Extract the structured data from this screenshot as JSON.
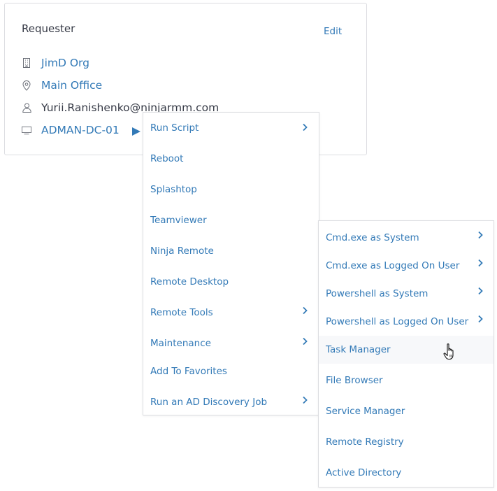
{
  "requester": {
    "title": "Requester",
    "edit_label": "Edit",
    "organization": "JimD Org",
    "location": "Main Office",
    "email": "Yurii.Ranishenko@ninjarmm.com",
    "device": "ADMAN-DC-01"
  },
  "icons": {
    "organization": "building-icon",
    "location": "map-pin-icon",
    "email": "user-icon",
    "device": "monitor-icon",
    "play": "play-icon",
    "submenu": "chevron-right-icon",
    "cursor": "hand-pointer-icon"
  },
  "device_menu": {
    "items": [
      {
        "label": "Run Script",
        "submenu": true
      },
      {
        "label": "Reboot",
        "submenu": false
      },
      {
        "label": "Splashtop",
        "submenu": false
      },
      {
        "label": "Teamviewer",
        "submenu": false
      },
      {
        "label": "Ninja Remote",
        "submenu": false
      },
      {
        "label": "Remote Desktop",
        "submenu": false
      },
      {
        "label": "Remote Tools",
        "submenu": true
      },
      {
        "label": "Maintenance",
        "submenu": true
      },
      {
        "label": "Add To Favorites",
        "submenu": false
      },
      {
        "label": "Run an AD Discovery Job",
        "submenu": true
      }
    ]
  },
  "remote_tools_menu": {
    "hovered_item": "Task Manager",
    "items": [
      {
        "label": "Cmd.exe as System",
        "submenu": true
      },
      {
        "label": "Cmd.exe as Logged On User",
        "submenu": true
      },
      {
        "label": "Powershell as System",
        "submenu": true
      },
      {
        "label": "Powershell as Logged On User",
        "submenu": true
      },
      {
        "label": "Task Manager",
        "submenu": false
      },
      {
        "label": "File Browser",
        "submenu": false
      },
      {
        "label": "Service Manager",
        "submenu": false
      },
      {
        "label": "Remote Registry",
        "submenu": false
      },
      {
        "label": "Active Directory",
        "submenu": false
      }
    ]
  },
  "colors": {
    "link": "#337ab7",
    "text": "#363a46",
    "icon": "#6b6f78",
    "border": "#dcdde1",
    "hover_bg": "#f7f8fa"
  }
}
